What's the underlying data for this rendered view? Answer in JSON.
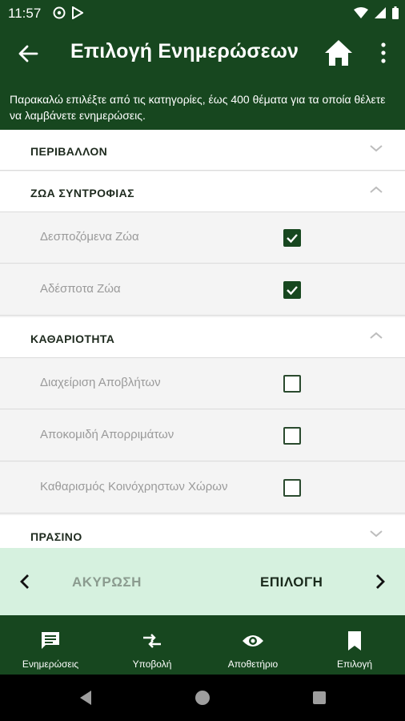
{
  "status_bar": {
    "time": "11:57",
    "icons": [
      "at-sign-icon",
      "play-store-icon",
      "wifi-icon",
      "signal-icon",
      "battery-icon"
    ]
  },
  "app_bar": {
    "title": "Επιλογή Ενημερώσεων",
    "icons": [
      "back-arrow-icon",
      "home-icon",
      "more-vertical-icon"
    ]
  },
  "description": "Παρακαλώ επιλέξτε από τις κατηγορίες, έως 400 θέματα για τα οποία θέλετε να λαμβάνετε ενημερώσεις.",
  "categories": [
    {
      "label": "ΠΕΡΙΒΑΛΛΟΝ",
      "expanded": false,
      "items": []
    },
    {
      "label": "ΖΩΑ ΣΥΝΤΡΟΦΙΑΣ",
      "expanded": true,
      "items": [
        {
          "label": "Δεσποζόμενα Ζώα",
          "checked": true
        },
        {
          "label": "Αδέσποτα Ζώα",
          "checked": true
        }
      ]
    },
    {
      "label": "ΚΑΘΑΡΙΟΤΗΤΑ",
      "expanded": true,
      "items": [
        {
          "label": "Διαχείριση Αποβλήτων",
          "checked": false
        },
        {
          "label": "Αποκομιδή Απορριμάτων",
          "checked": false
        },
        {
          "label": "Καθαρισμός Κοινόχρηστων Χώρων",
          "checked": false
        }
      ]
    },
    {
      "label": "ΠΡΑΣΙΝΟ",
      "expanded": false,
      "items": []
    }
  ],
  "action_bar": {
    "cancel_label": "ΑΚΥΡΩΣΗ",
    "select_label": "ΕΠΙΛΟΓΗ"
  },
  "bottom_nav": [
    {
      "label": "Ενημερώσεις",
      "icon": "message-icon"
    },
    {
      "label": "Υποβολή",
      "icon": "swap-arrows-icon"
    },
    {
      "label": "Αποθετήριο",
      "icon": "eye-icon"
    },
    {
      "label": "Επιλογή",
      "icon": "bookmark-icon"
    }
  ],
  "colors": {
    "primary": "#17471f",
    "action_bar_bg": "#d6f1df",
    "list_item_text": "#9a9a9a"
  }
}
